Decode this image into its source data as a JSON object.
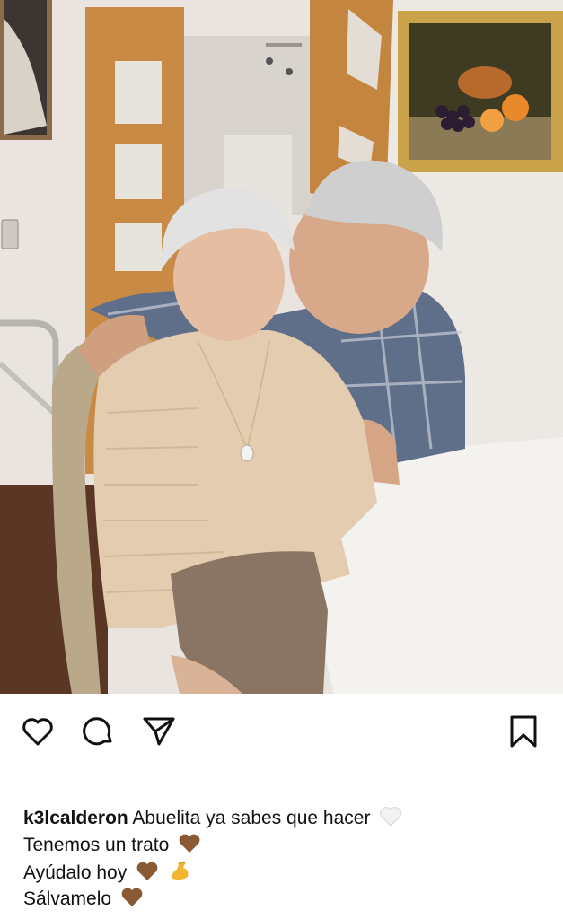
{
  "post": {
    "photo": {
      "subject": "family-photo",
      "icon": "post-photo"
    },
    "actions": {
      "like_icon": "heart-icon",
      "comment_icon": "comment-icon",
      "share_icon": "send-icon",
      "save_icon": "bookmark-icon"
    },
    "caption": {
      "username": "k3lcalderon",
      "lines": [
        {
          "text": "Abuelita ya sabes que hacer",
          "emojis": [
            "white-heart-icon"
          ]
        },
        {
          "text": "Tenemos un trato",
          "emojis": [
            "brown-heart-icon"
          ]
        },
        {
          "text": "Ayúdalo hoy",
          "emojis": [
            "brown-heart-icon",
            "flexed-biceps-icon"
          ]
        },
        {
          "text": "Sálvamelo",
          "emojis": [
            "brown-heart-icon"
          ]
        }
      ]
    }
  },
  "colors": {
    "background": "#ffffff",
    "text": "#111111",
    "icon": "#111111",
    "brown_heart": "#8a5a34",
    "white_heart": "#f3f3f3"
  }
}
